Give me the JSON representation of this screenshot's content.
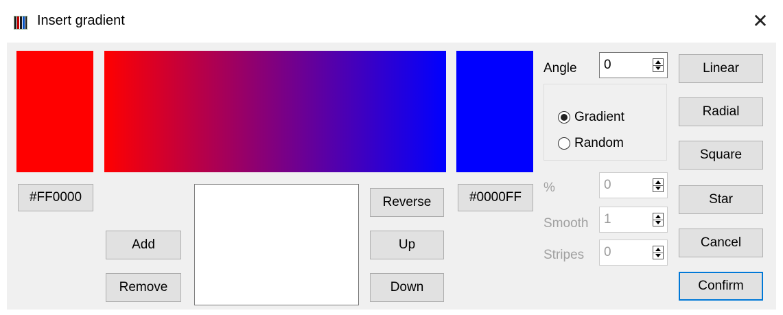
{
  "window": {
    "title": "Insert gradient"
  },
  "colors": {
    "start": "#FF0000",
    "end": "#0000FF"
  },
  "left_color": {
    "hex_label": "#FF0000"
  },
  "right_color": {
    "hex_label": "#0000FF"
  },
  "stops_buttons": {
    "add": "Add",
    "remove": "Remove"
  },
  "order_buttons": {
    "reverse": "Reverse",
    "up": "Up",
    "down": "Down"
  },
  "angle": {
    "label": "Angle",
    "value": "0"
  },
  "mode": {
    "gradient": "Gradient",
    "random": "Random",
    "selected": "gradient"
  },
  "options": {
    "percent_label": "%",
    "percent_value": "0",
    "smooth_label": "Smooth",
    "smooth_value": "1",
    "stripes_label": "Stripes",
    "stripes_value": "0"
  },
  "type_buttons": {
    "linear": "Linear",
    "radial": "Radial",
    "square": "Square",
    "star": "Star"
  },
  "dialog_buttons": {
    "cancel": "Cancel",
    "confirm": "Confirm"
  }
}
